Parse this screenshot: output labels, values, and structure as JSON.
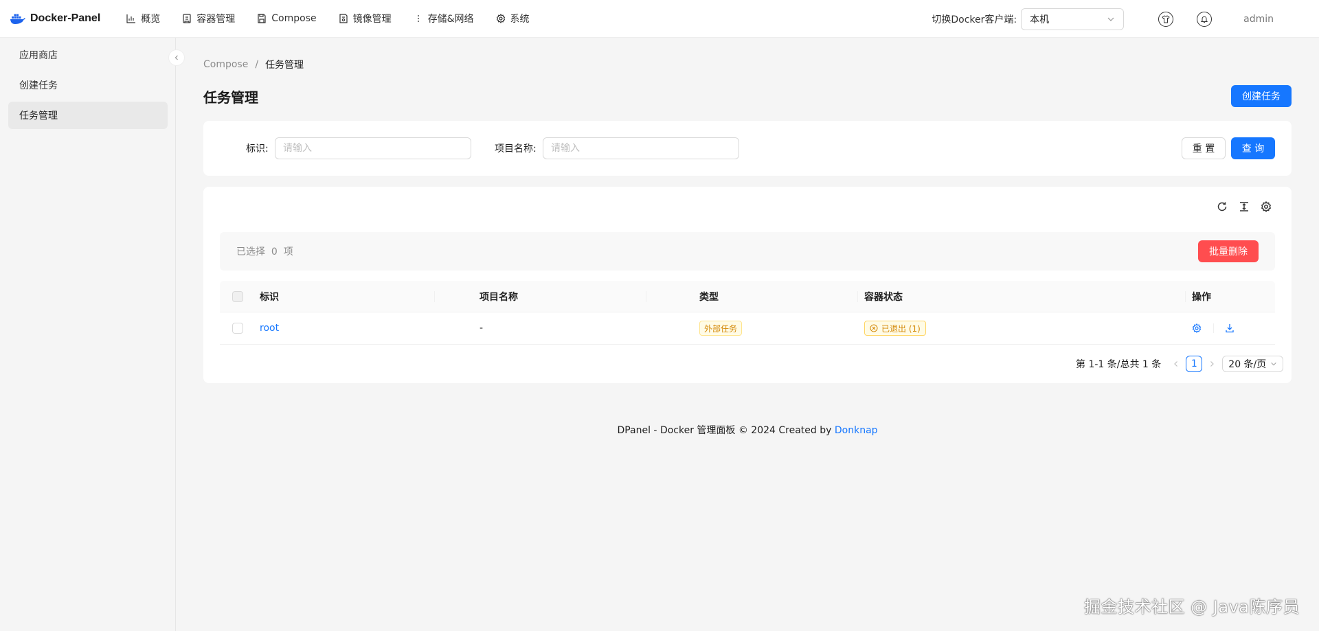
{
  "app": {
    "name": "Docker-Panel"
  },
  "nav": [
    {
      "label": "概览",
      "icon": "chart-icon"
    },
    {
      "label": "容器管理",
      "icon": "container-icon"
    },
    {
      "label": "Compose",
      "icon": "compose-icon"
    },
    {
      "label": "镜像管理",
      "icon": "image-icon"
    },
    {
      "label": "存储&网络",
      "icon": "more-vertical-icon"
    },
    {
      "label": "系统",
      "icon": "gear-icon"
    }
  ],
  "header": {
    "switch_label": "切换Docker客户端:",
    "client_value": "本机",
    "user": "admin"
  },
  "sidebar": {
    "items": [
      {
        "label": "应用商店"
      },
      {
        "label": "创建任务"
      },
      {
        "label": "任务管理",
        "active": true
      }
    ]
  },
  "breadcrumb": {
    "parent": "Compose",
    "separator": "/",
    "current": "任务管理"
  },
  "page": {
    "title": "任务管理",
    "create_button": "创建任务"
  },
  "search": {
    "id_label": "标识:",
    "id_placeholder": "请输入",
    "project_label": "项目名称:",
    "project_placeholder": "请输入",
    "reset_button": "重 置",
    "query_button": "查 询"
  },
  "selection": {
    "text": "已选择  0  项",
    "batch_delete": "批量删除"
  },
  "table": {
    "headers": [
      "标识",
      "项目名称",
      "类型",
      "容器状态",
      "操作"
    ],
    "rows": [
      {
        "id": "root",
        "project": "-",
        "type": "外部任务",
        "status": "已退出 (1)"
      }
    ]
  },
  "pagination": {
    "summary": "第 1-1 条/总共 1 条",
    "current": "1",
    "page_size": "20 条/页"
  },
  "footer": {
    "text": "DPanel - Docker 管理面板 © 2024 Created by ",
    "link": "Donknap"
  },
  "watermark": "掘金技术社区 @ Java陈序员",
  "colors": {
    "primary": "#1677ff",
    "danger": "#ff4d4f",
    "warning": "#d48806"
  }
}
